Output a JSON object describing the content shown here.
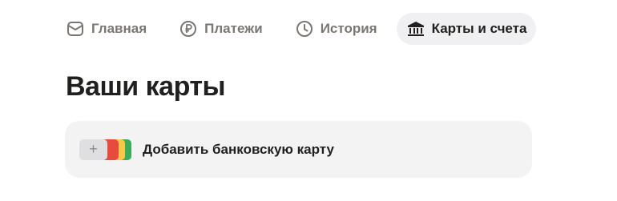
{
  "nav": {
    "items": [
      {
        "label": "Главная",
        "icon": "home-icon"
      },
      {
        "label": "Платежи",
        "icon": "ruble-icon"
      },
      {
        "label": "История",
        "icon": "clock-icon"
      },
      {
        "label": "Карты и счета",
        "icon": "bank-icon",
        "active": true
      }
    ]
  },
  "page": {
    "title": "Ваши карты"
  },
  "add_card": {
    "label": "Добавить банковскую карту",
    "plus_icon": "+",
    "stripe_colors": [
      "#e84a3d",
      "#f7c948",
      "#3daa5c"
    ]
  },
  "colors": {
    "active_tab_bg": "#f0f0f2",
    "inactive_text": "#7a7773",
    "active_text": "#21201f",
    "card_bg": "#f3f3f4"
  }
}
